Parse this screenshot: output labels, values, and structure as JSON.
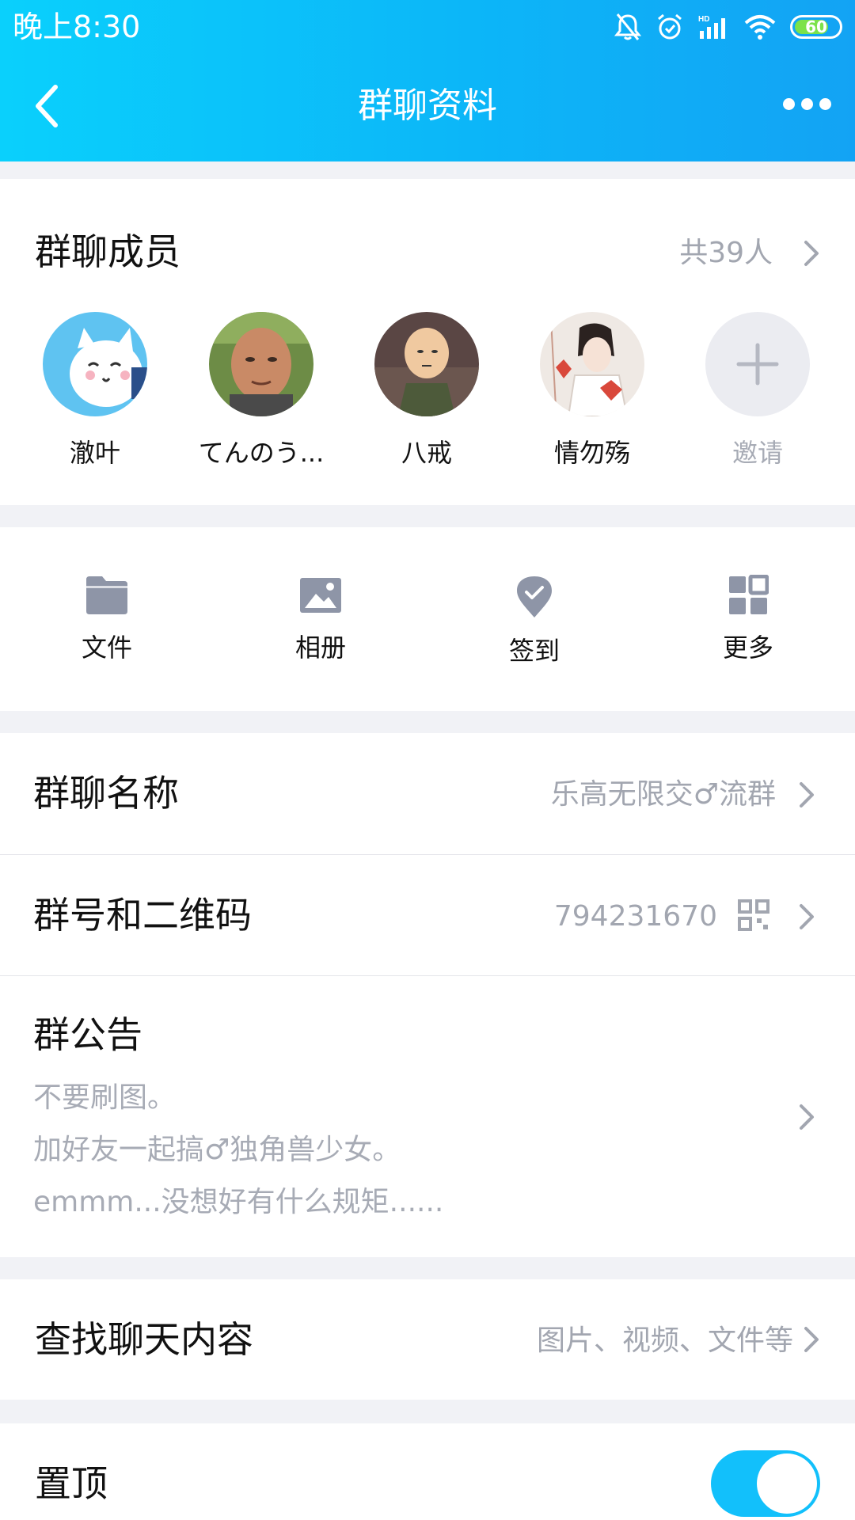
{
  "status_bar": {
    "time": "晚上8:30",
    "battery": "60"
  },
  "header": {
    "title": "群聊资料"
  },
  "members": {
    "title": "群聊成员",
    "count": "共39人",
    "list": [
      {
        "name": "澈叶"
      },
      {
        "name": "てんのう..."
      },
      {
        "name": "八戒"
      },
      {
        "name": "情勿殇"
      }
    ],
    "invite_label": "邀请"
  },
  "tools": [
    {
      "label": "文件",
      "icon": "folder-icon"
    },
    {
      "label": "相册",
      "icon": "image-icon"
    },
    {
      "label": "签到",
      "icon": "checkin-icon"
    },
    {
      "label": "更多",
      "icon": "grid-icon"
    }
  ],
  "group_name": {
    "label": "群聊名称",
    "value": "乐高无限交♂流群"
  },
  "group_number": {
    "label": "群号和二维码",
    "value": "794231670"
  },
  "announcement": {
    "label": "群公告",
    "lines": [
      "不要刷图。",
      "加好友一起搞♂独角兽少女。",
      "emmm...没想好有什么规矩......"
    ]
  },
  "search": {
    "label": "查找聊天内容",
    "value": "图片、视频、文件等"
  },
  "pin": {
    "label": "置顶",
    "enabled": true
  }
}
